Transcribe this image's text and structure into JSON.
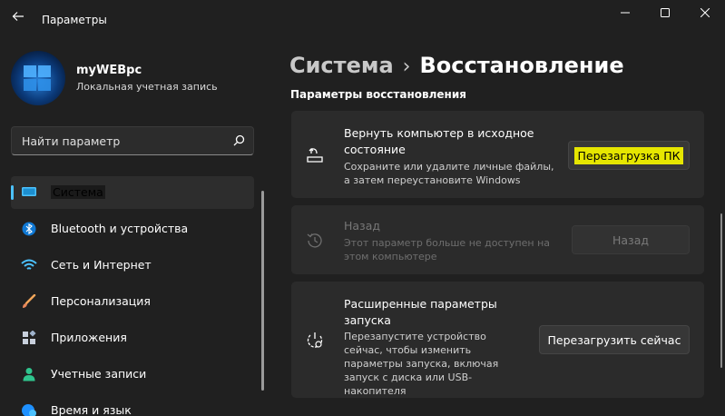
{
  "window": {
    "title": "Параметры"
  },
  "profile": {
    "name": "myWEBpc",
    "account_type": "Локальная учетная запись"
  },
  "search": {
    "placeholder": "Найти параметр"
  },
  "nav": {
    "items": [
      {
        "label": "Система",
        "icon": "monitor-icon",
        "active": true
      },
      {
        "label": "Bluetooth и устройства",
        "icon": "bluetooth-icon"
      },
      {
        "label": "Сеть и Интернет",
        "icon": "wifi-icon"
      },
      {
        "label": "Персонализация",
        "icon": "brush-icon"
      },
      {
        "label": "Приложения",
        "icon": "apps-icon"
      },
      {
        "label": "Учетные записи",
        "icon": "person-icon"
      },
      {
        "label": "Время и язык",
        "icon": "globe-clock-icon"
      }
    ]
  },
  "breadcrumb": {
    "parent": "Система",
    "separator": "›",
    "current": "Восстановление"
  },
  "section": {
    "title": "Параметры восстановления"
  },
  "cards": [
    {
      "title": "Вернуть компьютер в исходное состояние",
      "description": "Сохраните или удалите личные файлы, а затем переустановите Windows",
      "button": "Перезагрузка ПК",
      "icon": "reset-pc-icon"
    },
    {
      "title": "Назад",
      "description": "Этот параметр больше не доступен на этом компьютере",
      "button": "Назад",
      "icon": "history-icon",
      "disabled": true
    },
    {
      "title": "Расширенные параметры запуска",
      "description": "Перезапустите устройство сейчас, чтобы изменить параметры запуска, включая запуск с диска или USB-накопителя",
      "button": "Перезагрузить сейчас",
      "icon": "advanced-startup-icon"
    }
  ],
  "colors": {
    "background": "#202020",
    "card": "#2b2b2b",
    "accent": "#4cc2ff",
    "highlight": "#e6e600"
  }
}
